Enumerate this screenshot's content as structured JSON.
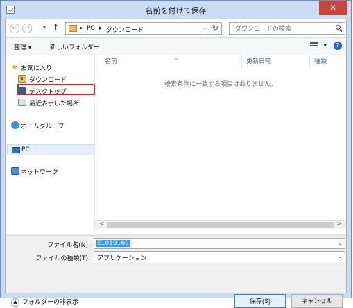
{
  "window": {
    "title": "名前を付けて保存",
    "close_glyph": "✕"
  },
  "nav": {
    "back": "←",
    "forward": "→",
    "recent_dropdown": "▾",
    "up": "↑"
  },
  "address": {
    "segments": [
      "PC",
      "ダウンロード"
    ],
    "separator": "▸",
    "dropdown": "⌄",
    "refresh": "↻"
  },
  "search": {
    "placeholder": "ダウンロードの検索"
  },
  "toolbar": {
    "organize": "整理 ▾",
    "new_folder": "新しいフォルダー",
    "view_dropdown": "▾"
  },
  "sidebar": {
    "favorites": "お気に入り",
    "downloads": "ダウンロード",
    "desktop": "デスクトップ",
    "recent": "最近表示した場所",
    "homegroup": "ホームグループ",
    "pc": "PC",
    "network": "ネットワーク"
  },
  "columns": {
    "name": "名前",
    "modified": "更新日時",
    "type": "種類",
    "sort_indicator": "^"
  },
  "content": {
    "empty_message": "検索条件に一致する項目はありません。"
  },
  "scrollbar": {
    "left": "<",
    "right": ">"
  },
  "form": {
    "filename_label": "ファイル名(N):",
    "filename_value": "E1019169",
    "filetype_label": "ファイルの種類(T):",
    "filetype_value": "アプリケーション",
    "dropdown": "⌄"
  },
  "footer": {
    "hide_folders": "フォルダーの非表示",
    "hide_icon": "▲",
    "save": "保存(S)",
    "cancel": "キャンセル"
  },
  "colors": {
    "accent": "#3399ff",
    "highlight": "#d8232a",
    "close": "#c9443a"
  },
  "icons": [
    "star-icon",
    "download-folder-icon",
    "desktop-icon",
    "recent-places-icon",
    "homegroup-icon",
    "pc-icon",
    "network-icon",
    "search-icon",
    "help-icon",
    "view-icon"
  ]
}
